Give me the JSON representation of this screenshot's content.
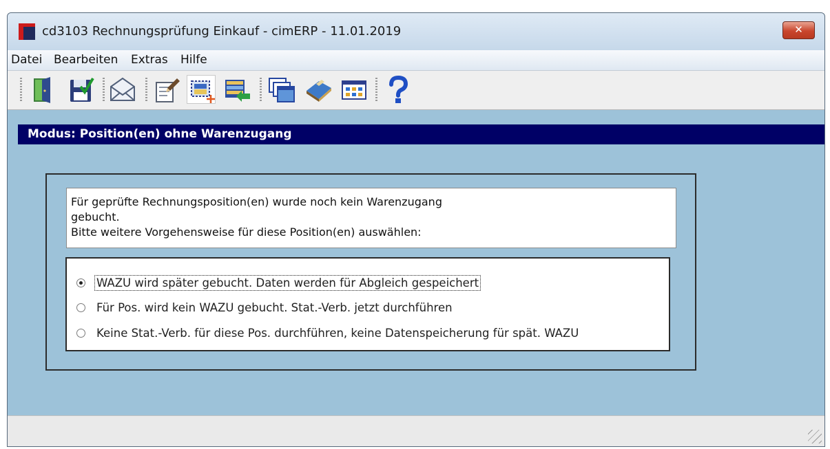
{
  "window": {
    "title": "cd3103 Rechnungsprüfung Einkauf - cimERP - 11.01.2019",
    "close_label": "✕"
  },
  "menu": {
    "items": [
      {
        "label": "Datei"
      },
      {
        "label": "Bearbeiten"
      },
      {
        "label": "Extras"
      },
      {
        "label": "Hilfe"
      }
    ]
  },
  "toolbar": {
    "buttons": [
      {
        "icon": "exit-door-icon"
      },
      {
        "icon": "save-check-icon"
      },
      {
        "icon": "envelope-icon"
      },
      {
        "icon": "edit-document-icon"
      },
      {
        "icon": "new-selection-icon"
      },
      {
        "icon": "transfer-list-icon"
      },
      {
        "icon": "windows-cascade-icon"
      },
      {
        "icon": "book-icon"
      },
      {
        "icon": "grid-view-icon"
      },
      {
        "icon": "help-icon"
      }
    ],
    "selected_index": 4
  },
  "mode_bar": {
    "text": "Modus: Position(en) ohne Warenzugang"
  },
  "info": {
    "lines": [
      "Für geprüfte Rechnungsposition(en) wurde noch kein Warenzugang",
      "gebucht.",
      "Bitte weitere Vorgehensweise für diese Position(en) auswählen:"
    ]
  },
  "options": [
    {
      "label": "WAZU wird später gebucht. Daten werden für Abgleich gespeichert",
      "checked": true
    },
    {
      "label": "Für Pos. wird kein WAZU gebucht. Stat.-Verb. jetzt durchführen",
      "checked": false
    },
    {
      "label": "Keine Stat.-Verb. für diese Pos. durchführen, keine Datenspeicherung für spät. WAZU",
      "checked": false
    }
  ],
  "colors": {
    "window_background": "#9dc2d9",
    "mode_bar": "#000066",
    "close_button": "#c9452c"
  }
}
